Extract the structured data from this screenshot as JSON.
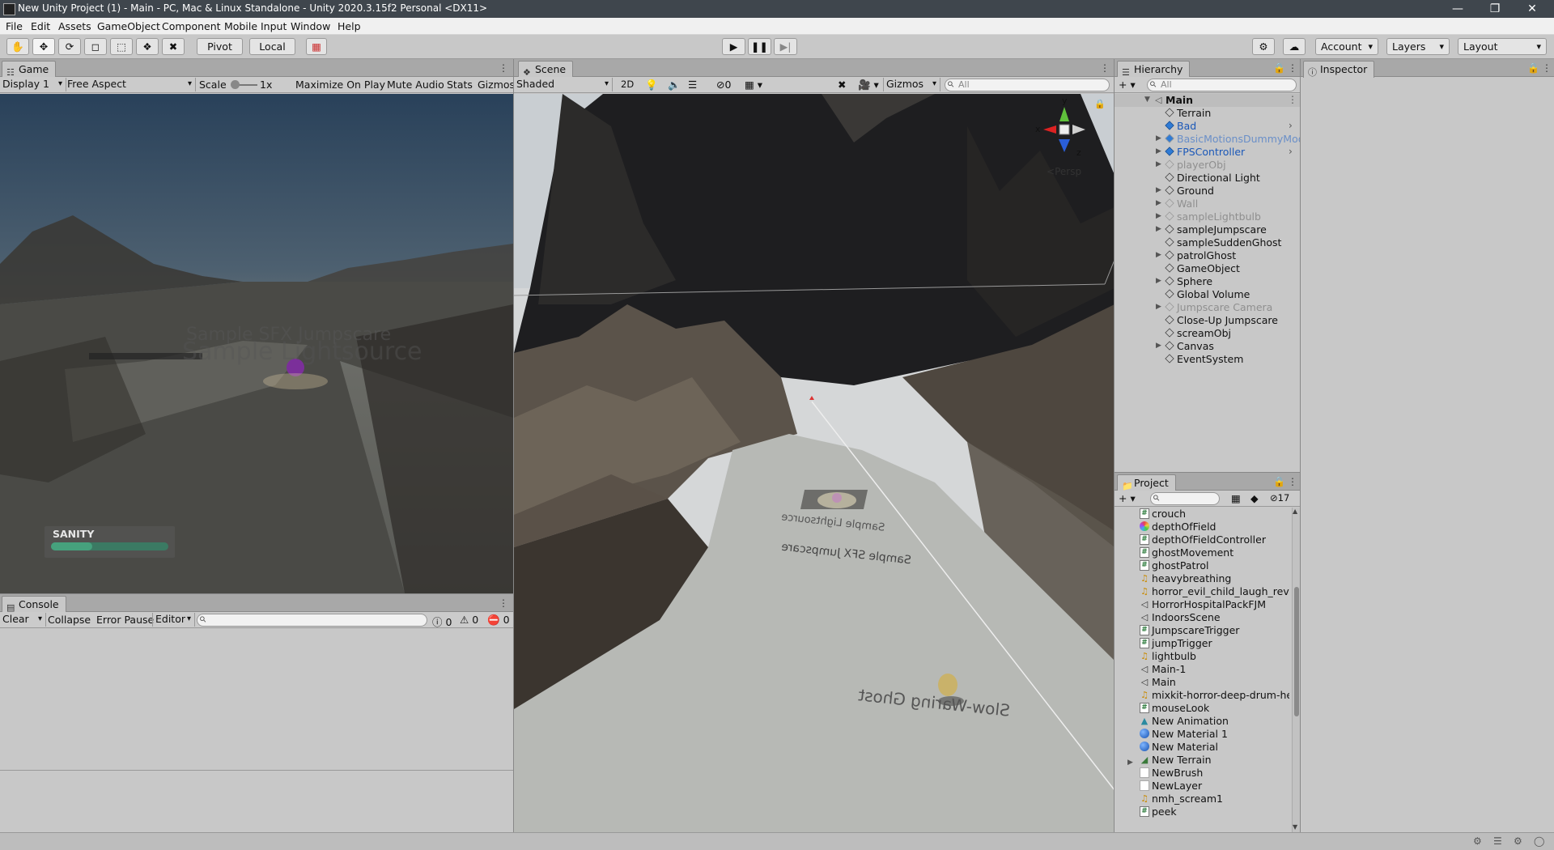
{
  "window": {
    "title": "New Unity Project (1) - Main - PC, Mac & Linux Standalone - Unity 2020.3.15f2 Personal <DX11>",
    "controls": [
      "—",
      "❐",
      "✕"
    ]
  },
  "menu": [
    "File",
    "Edit",
    "Assets",
    "GameObject",
    "Component",
    "Mobile Input",
    "Window",
    "Help"
  ],
  "toolbar": {
    "pivot": "Pivot",
    "local": "Local",
    "account": "Account",
    "layers": "Layers",
    "layout": "Layout"
  },
  "game": {
    "tab": "Game",
    "display": "Display 1",
    "aspect": "Free Aspect",
    "scale_label": "Scale",
    "scale_value": "1x",
    "maximize": "Maximize On Play",
    "mute": "Mute Audio",
    "stats": "Stats",
    "gizmos": "Gizmos",
    "overlay_text_1": "Sample SFX Jumpscare",
    "overlay_text_2": "Sample Lightsource",
    "sanity_label": "SANITY",
    "sanity_level": 0.35
  },
  "console": {
    "tab": "Console",
    "clear": "Clear",
    "collapse": "Collapse",
    "error_pause": "Error Pause",
    "editor": "Editor",
    "count_info": "0",
    "count_warn": "0",
    "count_error": "0"
  },
  "scene": {
    "tab": "Scene",
    "shading": "Shaded",
    "mode_2d": "2D",
    "hidden_count": "0",
    "gizmos": "Gizmos",
    "search_placeholder": "All",
    "persp": "Persp",
    "axis_y": "y",
    "axis_x": "x",
    "axis_z": "z",
    "label_lightsource": "Sample Lightsource",
    "label_sfx": "Sample SFX Jumpscare",
    "label_ghost": "Slow-Waring Ghost"
  },
  "hierarchy": {
    "tab": "Hierarchy",
    "search_placeholder": "All",
    "root": "Main",
    "items": [
      {
        "label": "Terrain",
        "style": "normal",
        "arrow": false,
        "more": false
      },
      {
        "label": "Bad",
        "style": "prefab",
        "arrow": false,
        "more": true
      },
      {
        "label": "BasicMotionsDummyMode",
        "style": "prefab-dim",
        "arrow": true,
        "more": false
      },
      {
        "label": "FPSController",
        "style": "prefab",
        "arrow": true,
        "more": true
      },
      {
        "label": "playerObj",
        "style": "dim",
        "arrow": true,
        "more": false
      },
      {
        "label": "Directional Light",
        "style": "normal",
        "arrow": false,
        "more": false
      },
      {
        "label": "Ground",
        "style": "normal",
        "arrow": true,
        "more": false
      },
      {
        "label": "Wall",
        "style": "dim",
        "arrow": true,
        "more": false
      },
      {
        "label": "sampleLightbulb",
        "style": "dim",
        "arrow": true,
        "more": false
      },
      {
        "label": "sampleJumpscare",
        "style": "normal",
        "arrow": true,
        "more": false
      },
      {
        "label": "sampleSuddenGhost",
        "style": "normal",
        "arrow": false,
        "more": false
      },
      {
        "label": "patrolGhost",
        "style": "normal",
        "arrow": true,
        "more": false
      },
      {
        "label": "GameObject",
        "style": "normal",
        "arrow": false,
        "more": false
      },
      {
        "label": "Sphere",
        "style": "normal",
        "arrow": true,
        "more": false
      },
      {
        "label": "Global Volume",
        "style": "normal",
        "arrow": false,
        "more": false
      },
      {
        "label": "Jumpscare Camera",
        "style": "dim",
        "arrow": true,
        "more": false
      },
      {
        "label": "Close-Up Jumpscare",
        "style": "normal",
        "arrow": false,
        "more": false
      },
      {
        "label": "screamObj",
        "style": "normal",
        "arrow": false,
        "more": false
      },
      {
        "label": "Canvas",
        "style": "normal",
        "arrow": true,
        "more": false
      },
      {
        "label": "EventSystem",
        "style": "normal",
        "arrow": false,
        "more": false
      }
    ]
  },
  "project": {
    "tab": "Project",
    "hidden_count": "17",
    "items": [
      {
        "label": "crouch",
        "icon": "cs"
      },
      {
        "label": "depthOfField",
        "icon": "dof"
      },
      {
        "label": "depthOfFieldController",
        "icon": "cs"
      },
      {
        "label": "ghostMovement",
        "icon": "cs"
      },
      {
        "label": "ghostPatrol",
        "icon": "cs"
      },
      {
        "label": "heavybreathing",
        "icon": "audio"
      },
      {
        "label": "horror_evil_child_laugh_reversed",
        "icon": "audio"
      },
      {
        "label": "HorrorHospitalPackFJM",
        "icon": "scene"
      },
      {
        "label": "IndoorsScene",
        "icon": "scene"
      },
      {
        "label": "JumpscareTrigger",
        "icon": "cs"
      },
      {
        "label": "jumpTrigger",
        "icon": "cs"
      },
      {
        "label": "lightbulb",
        "icon": "audio"
      },
      {
        "label": "Main-1",
        "icon": "scene"
      },
      {
        "label": "Main",
        "icon": "scene"
      },
      {
        "label": "mixkit-horror-deep-drum-heartbeat",
        "icon": "audio"
      },
      {
        "label": "mouseLook",
        "icon": "cs"
      },
      {
        "label": "New Animation",
        "icon": "anim"
      },
      {
        "label": "New Material 1",
        "icon": "mat"
      },
      {
        "label": "New Material",
        "icon": "mat"
      },
      {
        "label": "New Terrain",
        "icon": "terrain"
      },
      {
        "label": "NewBrush",
        "icon": "blank"
      },
      {
        "label": "NewLayer",
        "icon": "blank"
      },
      {
        "label": "nmh_scream1",
        "icon": "audio"
      },
      {
        "label": "peek",
        "icon": "cs"
      }
    ]
  },
  "inspector": {
    "tab": "Inspector"
  }
}
